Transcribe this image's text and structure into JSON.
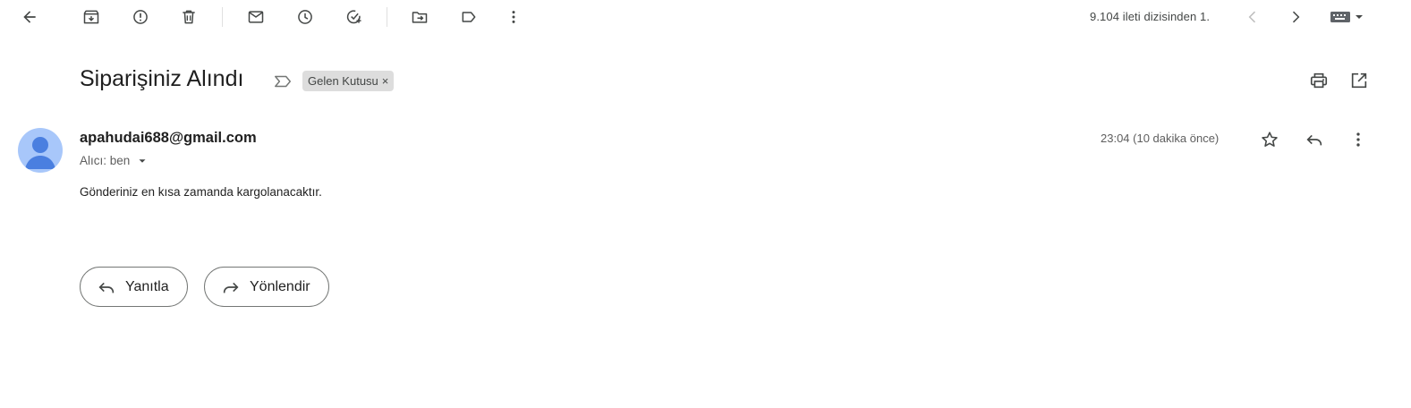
{
  "toolbar": {
    "icons": [
      "back-arrow-icon",
      "archive-icon",
      "report-spam-icon",
      "delete-icon",
      "mark-unread-icon",
      "snooze-icon",
      "add-to-tasks-icon",
      "move-to-icon",
      "label-icon",
      "more-vert-icon"
    ],
    "pager_text": "9.104 ileti dizisinden 1."
  },
  "subject": {
    "text": "Siparişiniz Alındı",
    "label": "Gelen Kutusu",
    "label_remove": "×"
  },
  "message": {
    "sender": "apahudai688@gmail.com",
    "recipient": "Alıcı: ben",
    "time": "23:04 (10 dakika önce)",
    "body": "Gönderiniz en kısa zamanda kargolanacaktır."
  },
  "actions": {
    "reply_label": "Yanıtla",
    "forward_label": "Yönlendir"
  },
  "colors": {
    "avatar_bg": "#a8c7fa",
    "avatar_fg": "#4a7fe0",
    "chip_bg": "#dddddd",
    "icon": "#444746"
  }
}
